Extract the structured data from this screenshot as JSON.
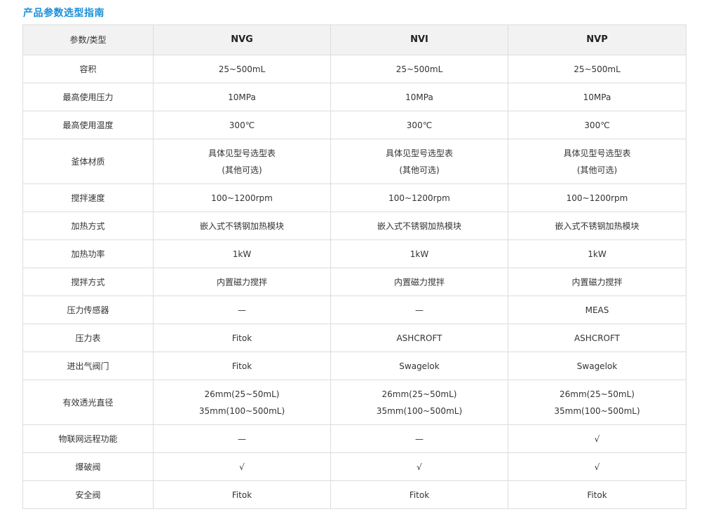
{
  "title": "产品参数选型指南",
  "table": {
    "header": [
      "参数/类型",
      "NVG",
      "NVI",
      "NVP"
    ],
    "rows": [
      {
        "label": "容积",
        "values": [
          [
            "25~500mL"
          ],
          [
            "25~500mL"
          ],
          [
            "25~500mL"
          ]
        ]
      },
      {
        "label": "最高使用压力",
        "values": [
          [
            "10MPa"
          ],
          [
            "10MPa"
          ],
          [
            "10MPa"
          ]
        ]
      },
      {
        "label": "最高使用温度",
        "values": [
          [
            "300℃"
          ],
          [
            "300℃"
          ],
          [
            "300℃"
          ]
        ]
      },
      {
        "label": "釜体材质",
        "values": [
          [
            "具体见型号选型表",
            "(其他可选)"
          ],
          [
            "具体见型号选型表",
            "(其他可选)"
          ],
          [
            "具体见型号选型表",
            "(其他可选)"
          ]
        ]
      },
      {
        "label": "搅拌速度",
        "values": [
          [
            "100~1200rpm"
          ],
          [
            "100~1200rpm"
          ],
          [
            "100~1200rpm"
          ]
        ]
      },
      {
        "label": "加热方式",
        "values": [
          [
            "嵌入式不锈钢加热模块"
          ],
          [
            "嵌入式不锈钢加热模块"
          ],
          [
            "嵌入式不锈钢加热模块"
          ]
        ]
      },
      {
        "label": "加热功率",
        "values": [
          [
            "1kW"
          ],
          [
            "1kW"
          ],
          [
            "1kW"
          ]
        ]
      },
      {
        "label": "搅拌方式",
        "values": [
          [
            "内置磁力搅拌"
          ],
          [
            "内置磁力搅拌"
          ],
          [
            "内置磁力搅拌"
          ]
        ]
      },
      {
        "label": "压力传感器",
        "values": [
          [
            "—"
          ],
          [
            "—"
          ],
          [
            "MEAS"
          ]
        ]
      },
      {
        "label": "压力表",
        "values": [
          [
            "Fitok"
          ],
          [
            "ASHCROFT"
          ],
          [
            "ASHCROFT"
          ]
        ]
      },
      {
        "label": "进出气阀门",
        "values": [
          [
            "Fitok"
          ],
          [
            "Swagelok"
          ],
          [
            "Swagelok"
          ]
        ]
      },
      {
        "label": "有效透光直径",
        "values": [
          [
            "26mm(25~50mL)",
            "35mm(100~500mL)"
          ],
          [
            "26mm(25~50mL)",
            "35mm(100~500mL)"
          ],
          [
            "26mm(25~50mL)",
            "35mm(100~500mL)"
          ]
        ]
      },
      {
        "label": "物联网远程功能",
        "values": [
          [
            "—"
          ],
          [
            "—"
          ],
          [
            "√"
          ]
        ]
      },
      {
        "label": "爆破阀",
        "values": [
          [
            "√"
          ],
          [
            "√"
          ],
          [
            "√"
          ]
        ]
      },
      {
        "label": "安全阀",
        "values": [
          [
            "Fitok"
          ],
          [
            "Fitok"
          ],
          [
            "Fitok"
          ]
        ]
      }
    ]
  }
}
